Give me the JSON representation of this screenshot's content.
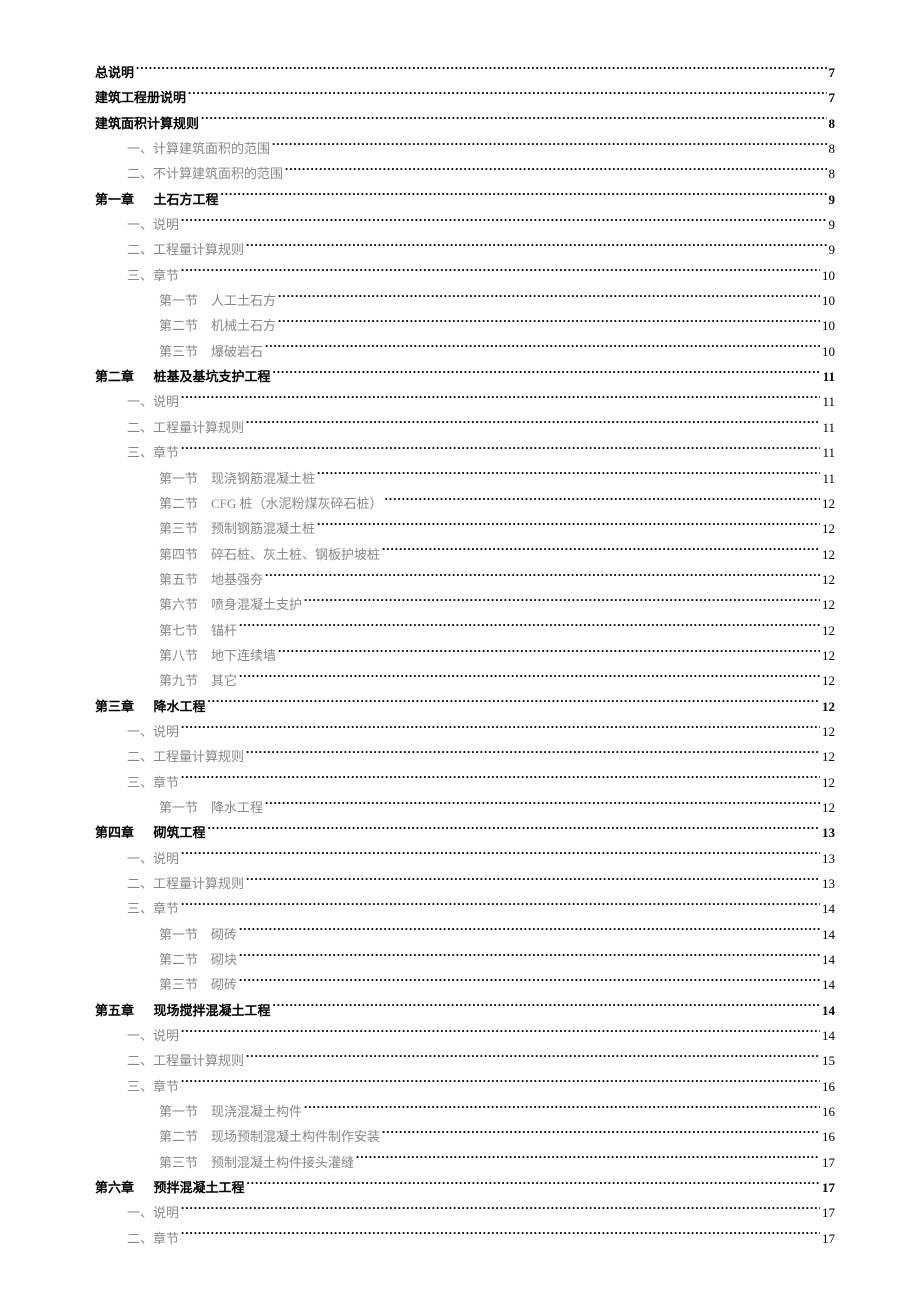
{
  "toc": [
    {
      "level": 0,
      "title": "总说明",
      "page": "7"
    },
    {
      "level": 0,
      "title": "建筑工程册说明",
      "page": "7"
    },
    {
      "level": 0,
      "title": "建筑面积计算规则",
      "page": "8"
    },
    {
      "level": 1,
      "title": "一、计算建筑面积的范围",
      "page": "8"
    },
    {
      "level": 1,
      "title": "二、不计算建筑面积的范围",
      "page": "8"
    },
    {
      "level": 0,
      "chapter": "第一章",
      "title": "土石方工程",
      "page": "9"
    },
    {
      "level": 1,
      "title": "一、说明",
      "page": "9"
    },
    {
      "level": 1,
      "title": "二、工程量计算规则",
      "page": "9"
    },
    {
      "level": 1,
      "title": "三、章节",
      "page": "10"
    },
    {
      "level": 2,
      "section": "第一节",
      "title": "人工土石方",
      "page": "10"
    },
    {
      "level": 2,
      "section": "第二节",
      "title": "机械土石方",
      "page": "10"
    },
    {
      "level": 2,
      "section": "第三节",
      "title": "爆破岩石",
      "page": "10"
    },
    {
      "level": 0,
      "chapter": "第二章",
      "title": "桩基及基坑支护工程",
      "page": "11"
    },
    {
      "level": 1,
      "title": "一、说明",
      "page": "11"
    },
    {
      "level": 1,
      "title": "二、工程量计算规则",
      "page": "11"
    },
    {
      "level": 1,
      "title": "三、章节",
      "page": "11"
    },
    {
      "level": 2,
      "section": "第一节",
      "title": "现浇钢筋混凝土桩",
      "page": "11"
    },
    {
      "level": 2,
      "section": "第二节",
      "title": "CFG 桩（水泥粉煤灰碎石桩）",
      "page": "12"
    },
    {
      "level": 2,
      "section": "第三节",
      "title": "预制钢筋混凝土桩",
      "page": "12"
    },
    {
      "level": 2,
      "section": "第四节",
      "title": "碎石桩、灰土桩、钢板护坡桩",
      "page": "12"
    },
    {
      "level": 2,
      "section": "第五节",
      "title": "地基强夯",
      "page": "12"
    },
    {
      "level": 2,
      "section": "第六节",
      "title": "喷身混凝土支护",
      "page": "12"
    },
    {
      "level": 2,
      "section": "第七节",
      "title": "锚杆",
      "page": "12"
    },
    {
      "level": 2,
      "section": "第八节",
      "title": "地下连续墙",
      "page": "12"
    },
    {
      "level": 2,
      "section": "第九节",
      "title": "其它",
      "page": "12"
    },
    {
      "level": 0,
      "chapter": "第三章",
      "title": "降水工程",
      "page": "12"
    },
    {
      "level": 1,
      "title": "一、说明",
      "page": "12"
    },
    {
      "level": 1,
      "title": "二、工程量计算规则",
      "page": "12"
    },
    {
      "level": 1,
      "title": "三、章节",
      "page": "12"
    },
    {
      "level": 2,
      "section": "第一节",
      "title": "降水工程",
      "page": "12"
    },
    {
      "level": 0,
      "chapter": "第四章",
      "title": "砌筑工程",
      "page": "13"
    },
    {
      "level": 1,
      "title": "一、说明",
      "page": "13"
    },
    {
      "level": 1,
      "title": "二、工程量计算规则",
      "page": "13"
    },
    {
      "level": 1,
      "title": "三、章节",
      "page": "14"
    },
    {
      "level": 2,
      "section": "第一节",
      "title": "砌砖",
      "page": "14"
    },
    {
      "level": 2,
      "section": "第二节",
      "title": "砌块",
      "page": "14"
    },
    {
      "level": 2,
      "section": "第三节",
      "title": "砌砖",
      "page": "14"
    },
    {
      "level": 0,
      "chapter": "第五章",
      "title": "现场搅拌混凝土工程",
      "page": "14"
    },
    {
      "level": 1,
      "title": "一、说明",
      "page": "14"
    },
    {
      "level": 1,
      "title": "二、工程量计算规则",
      "page": "15"
    },
    {
      "level": 1,
      "title": "三、章节",
      "page": "16"
    },
    {
      "level": 2,
      "section": "第一节",
      "title": "现浇混凝土构件",
      "page": "16"
    },
    {
      "level": 2,
      "section": "第二节",
      "title": "现场预制混凝土构件制作安装",
      "page": "16"
    },
    {
      "level": 2,
      "section": "第三节",
      "title": "预制混凝土构件接头灌缝",
      "page": "17"
    },
    {
      "level": 0,
      "chapter": "第六章",
      "title": "预拌混凝土工程",
      "page": "17"
    },
    {
      "level": 1,
      "title": "一、说明",
      "page": "17"
    },
    {
      "level": 1,
      "title": "二、章节",
      "page": "17"
    }
  ]
}
